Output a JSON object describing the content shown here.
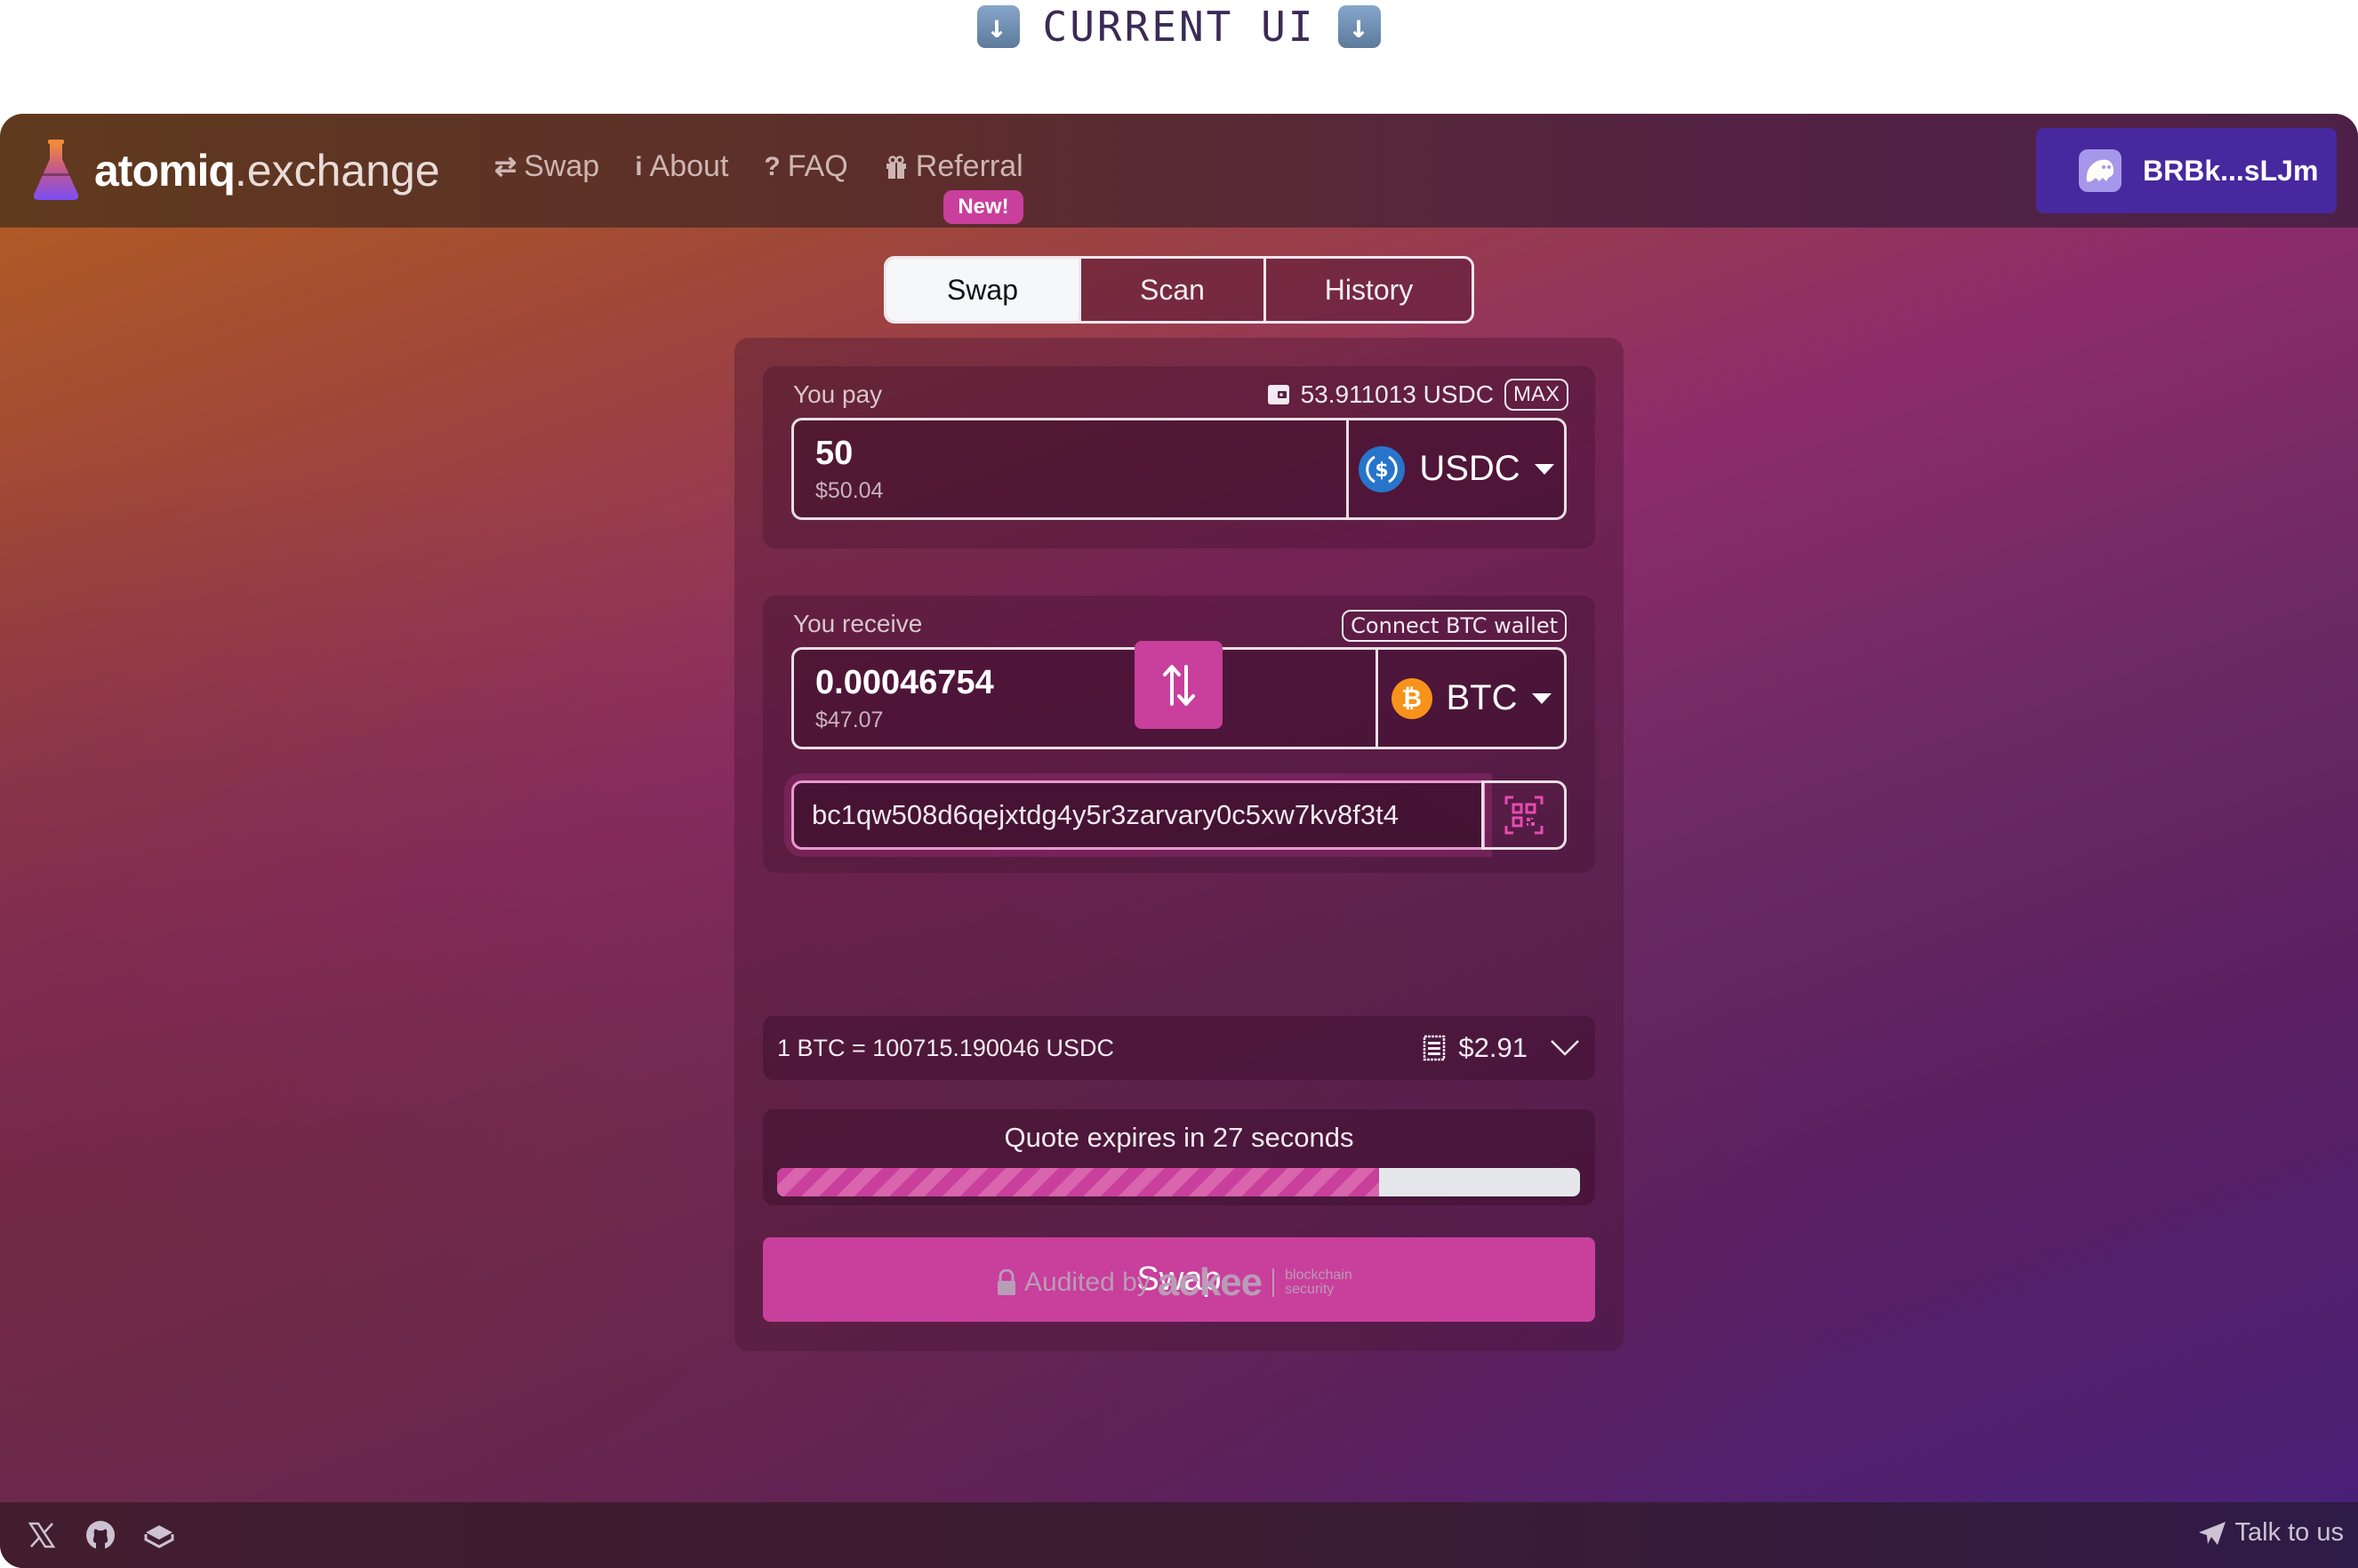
{
  "banner": {
    "text": "CURRENT UI"
  },
  "header": {
    "brand_bold": "atomiq",
    "brand_light": ".exchange",
    "nav": [
      {
        "label": "Swap",
        "icon": "swap-arrows-icon"
      },
      {
        "label": "About",
        "icon": "info-icon"
      },
      {
        "label": "FAQ",
        "icon": "question-icon"
      },
      {
        "label": "Referral",
        "icon": "gift-icon"
      }
    ],
    "new_badge": "New!",
    "wallet_address": "BRBk...sLJm"
  },
  "tabs": [
    {
      "label": "Swap",
      "active": true
    },
    {
      "label": "Scan",
      "active": false
    },
    {
      "label": "History",
      "active": false
    }
  ],
  "pay": {
    "label": "You pay",
    "balance": "53.911013 USDC",
    "max_label": "MAX",
    "amount": "50",
    "usd_value": "$50.04",
    "token": "USDC"
  },
  "receive": {
    "label": "You receive",
    "connect_label": "Connect BTC wallet",
    "amount": "0.00046754",
    "usd_value": "$47.07",
    "token": "BTC",
    "address": "bc1qw508d6qejxtdg4y5r3zarvary0c5xw7kv8f3t4"
  },
  "rate": {
    "text": "1 BTC = 100715.190046 USDC",
    "fee": "$2.91"
  },
  "quote": {
    "text": "Quote expires in 27 seconds",
    "progress_fraction": 0.75
  },
  "swap_button": "Swap",
  "audited": {
    "prefix": "Audited by",
    "brand": "ackee",
    "sub1": "blockchain",
    "sub2": "security"
  },
  "footer": {
    "social": [
      "x-icon",
      "github-icon",
      "gitbook-icon"
    ],
    "talk_label": "Talk to us"
  },
  "colors": {
    "accent": "#c93f9c",
    "wallet_button": "#47289e",
    "usdc": "#2775ca",
    "btc": "#f7931a"
  }
}
